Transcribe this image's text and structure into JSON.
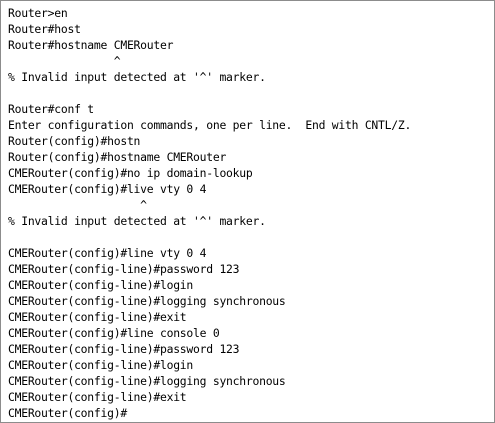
{
  "terminal": {
    "lines": [
      "Router>en",
      "Router#host",
      "Router#hostname CMERouter",
      "                ^",
      "% Invalid input detected at '^' marker.",
      "",
      "Router#conf t",
      "Enter configuration commands, one per line.  End with CNTL/Z.",
      "Router(config)#hostn",
      "Router(config)#hostname CMERouter",
      "CMERouter(config)#no ip domain-lookup",
      "CMERouter(config)#live vty 0 4",
      "                    ^",
      "% Invalid input detected at '^' marker.",
      "",
      "CMERouter(config)#line vty 0 4",
      "CMERouter(config-line)#password 123",
      "CMERouter(config-line)#login",
      "CMERouter(config-line)#logging synchronous",
      "CMERouter(config-line)#exit",
      "CMERouter(config)#line console 0",
      "CMERouter(config-line)#password 123",
      "CMERouter(config-line)#login",
      "CMERouter(config-line)#logging synchronous",
      "CMERouter(config-line)#exit",
      "CMERouter(config)#"
    ]
  }
}
